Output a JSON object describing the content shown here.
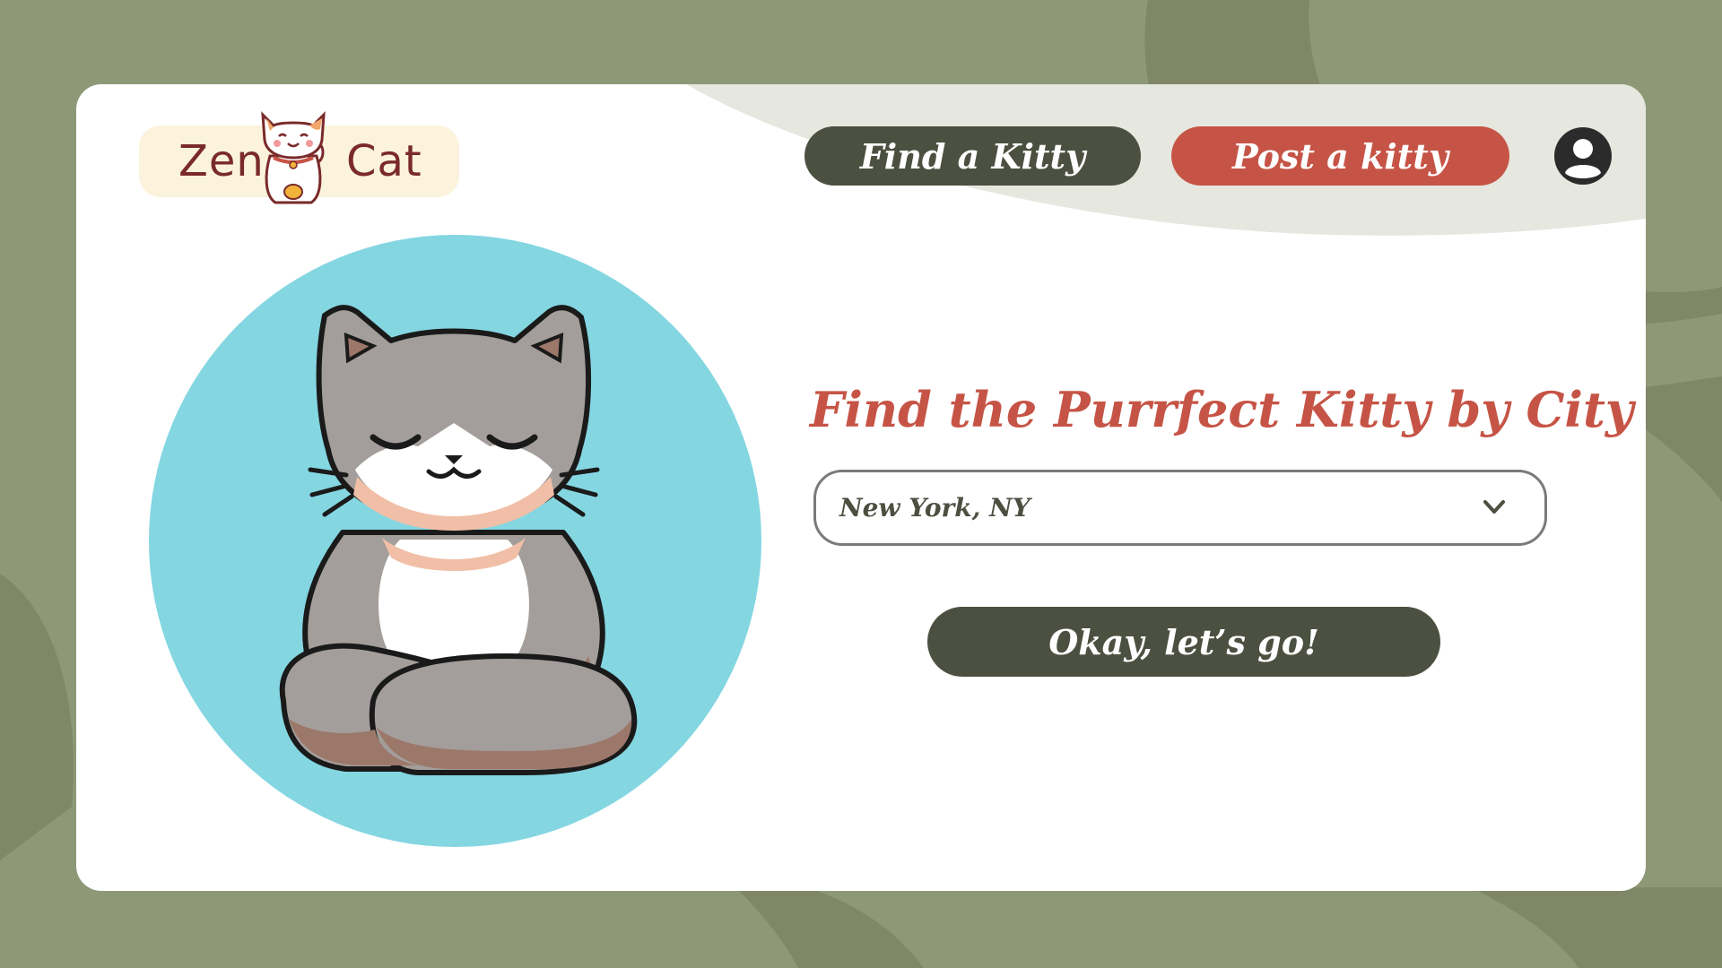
{
  "logo": {
    "word_left": "Zen",
    "word_right": "Cat",
    "mascot_icon": "lucky-cat-icon"
  },
  "nav": {
    "find_label": "Find a Kitty",
    "post_label": "Post a kitty",
    "profile_icon": "user-avatar-icon"
  },
  "hero": {
    "illustration_icon": "meditating-cat-illustration"
  },
  "search": {
    "headline": "Find the Purrfect Kitty by City",
    "city_selected": "New York, NY",
    "dropdown_icon": "chevron-down-icon",
    "submit_label": "Okay, let’s go!"
  },
  "colors": {
    "background": "#8e9876",
    "dark_olive": "#4b5040",
    "coral": "#c65446",
    "sky": "#84d6e1",
    "cream": "#fbf3dc"
  }
}
